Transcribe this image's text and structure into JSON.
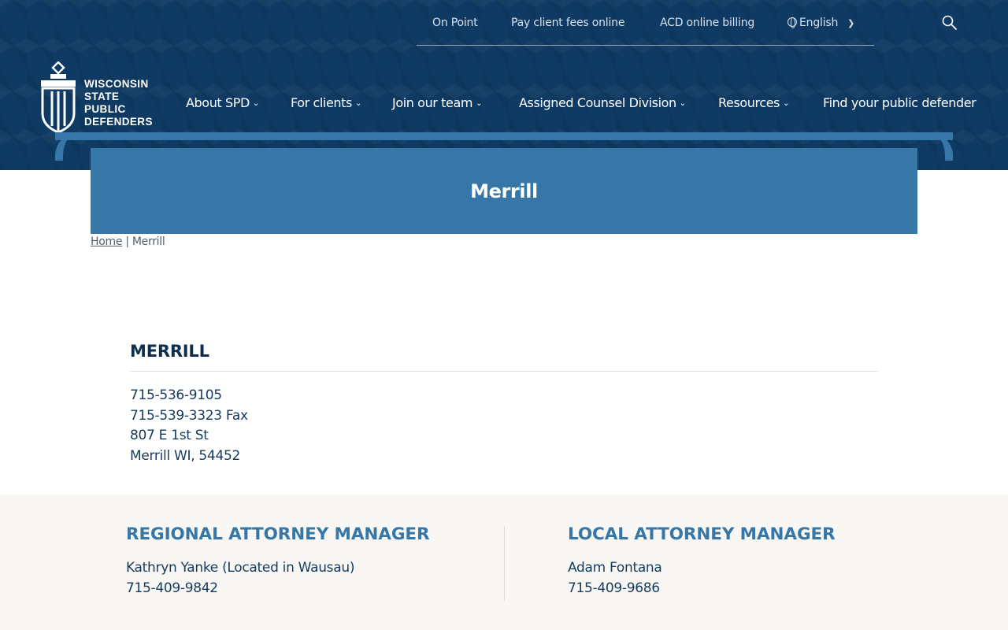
{
  "utility_nav": {
    "links": [
      "On Point",
      "Pay client fees online",
      "ACD online billing"
    ],
    "language": "English",
    "language_icon": "globe-icon",
    "search_icon": "search-icon"
  },
  "logo": {
    "lines": [
      "WISCONSIN",
      "STATE",
      "PUBLIC",
      "DEFENDERS"
    ]
  },
  "main_nav": {
    "items": [
      {
        "label": "About SPD",
        "has_dropdown": true
      },
      {
        "label": "For clients",
        "has_dropdown": true
      },
      {
        "label": "Join our team",
        "has_dropdown": true
      },
      {
        "label": "Assigned Counsel Division",
        "has_dropdown": true
      },
      {
        "label": "Resources",
        "has_dropdown": true
      },
      {
        "label": "Find your public defender",
        "has_dropdown": false
      }
    ]
  },
  "banner": {
    "title": "Merrill"
  },
  "breadcrumb": {
    "home": "Home",
    "separator": "|",
    "current": "Merrill"
  },
  "office": {
    "heading": "MERRILL",
    "phone": "715-536-9105",
    "fax": "715-539-3323 Fax",
    "street": "807 E 1st St",
    "city": "Merrill WI, 54452"
  },
  "managers": {
    "regional": {
      "heading": "REGIONAL ATTORNEY MANAGER",
      "name": "Kathryn Yanke (Located in Wausau)",
      "phone": "715-409-9842"
    },
    "local": {
      "heading": "LOCAL ATTORNEY MANAGER",
      "name": "Adam Fontana",
      "phone": "715-409-9686"
    }
  },
  "colors": {
    "header_bg": "#0f3a63",
    "accent_blue": "#3677a8",
    "text_navy": "#0d2e4f",
    "footer_bg": "#f8f7f4"
  }
}
